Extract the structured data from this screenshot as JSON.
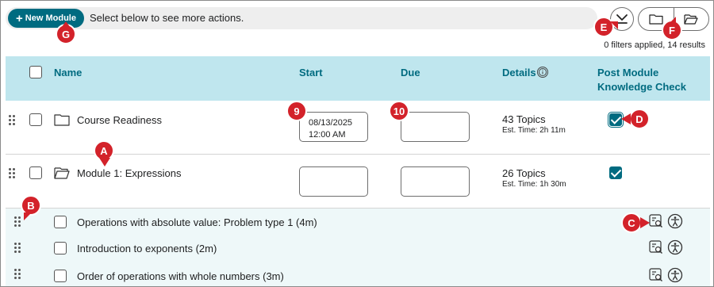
{
  "toolbar": {
    "new_module_label": "New Module",
    "new_module_icon": "plus-icon",
    "hint": "Select below to see more actions.",
    "collapse_icon": "collapse-all-icon",
    "folder_closed_icon": "folder-icon",
    "folder_open_icon": "folder-open-icon"
  },
  "results_summary": "0 filters applied, 14 results",
  "columns": {
    "name": "Name",
    "start": "Start",
    "due": "Due",
    "details": "Details",
    "details_info_icon": "info-icon",
    "knowledge_check_line1": "Post Module",
    "knowledge_check_line2": "Knowledge Check"
  },
  "modules": [
    {
      "name": "Course Readiness",
      "icon": "folder-icon",
      "start_date": "08/13/2025",
      "start_time": "12:00 AM",
      "due": "",
      "topics": "43 Topics",
      "est_time": "Est. Time: 2h 11m",
      "knowledge_check": true
    },
    {
      "name": "Module 1: Expressions",
      "icon": "folder-open-icon",
      "start_date": "",
      "start_time": "",
      "due": "",
      "topics": "26 Topics",
      "est_time": "Est. Time: 1h 30m",
      "knowledge_check": true
    }
  ],
  "topics": [
    {
      "name": "Operations with absolute value: Problem type 1 (4m)"
    },
    {
      "name": "Introduction to exponents (2m)"
    },
    {
      "name": "Order of operations with whole numbers (3m)"
    }
  ],
  "topic_actions": {
    "preview_icon": "preview-icon",
    "accessibility_icon": "accessibility-icon"
  },
  "callouts": {
    "A": "A",
    "B": "B",
    "C": "C",
    "D": "D",
    "E": "E",
    "F": "F",
    "G": "G",
    "n9": "9",
    "n10": "10"
  },
  "colors": {
    "accent": "#006b80",
    "header_bg": "#bfe6ee",
    "topic_row_bg": "#eef8f9",
    "callout": "#d3222a"
  }
}
